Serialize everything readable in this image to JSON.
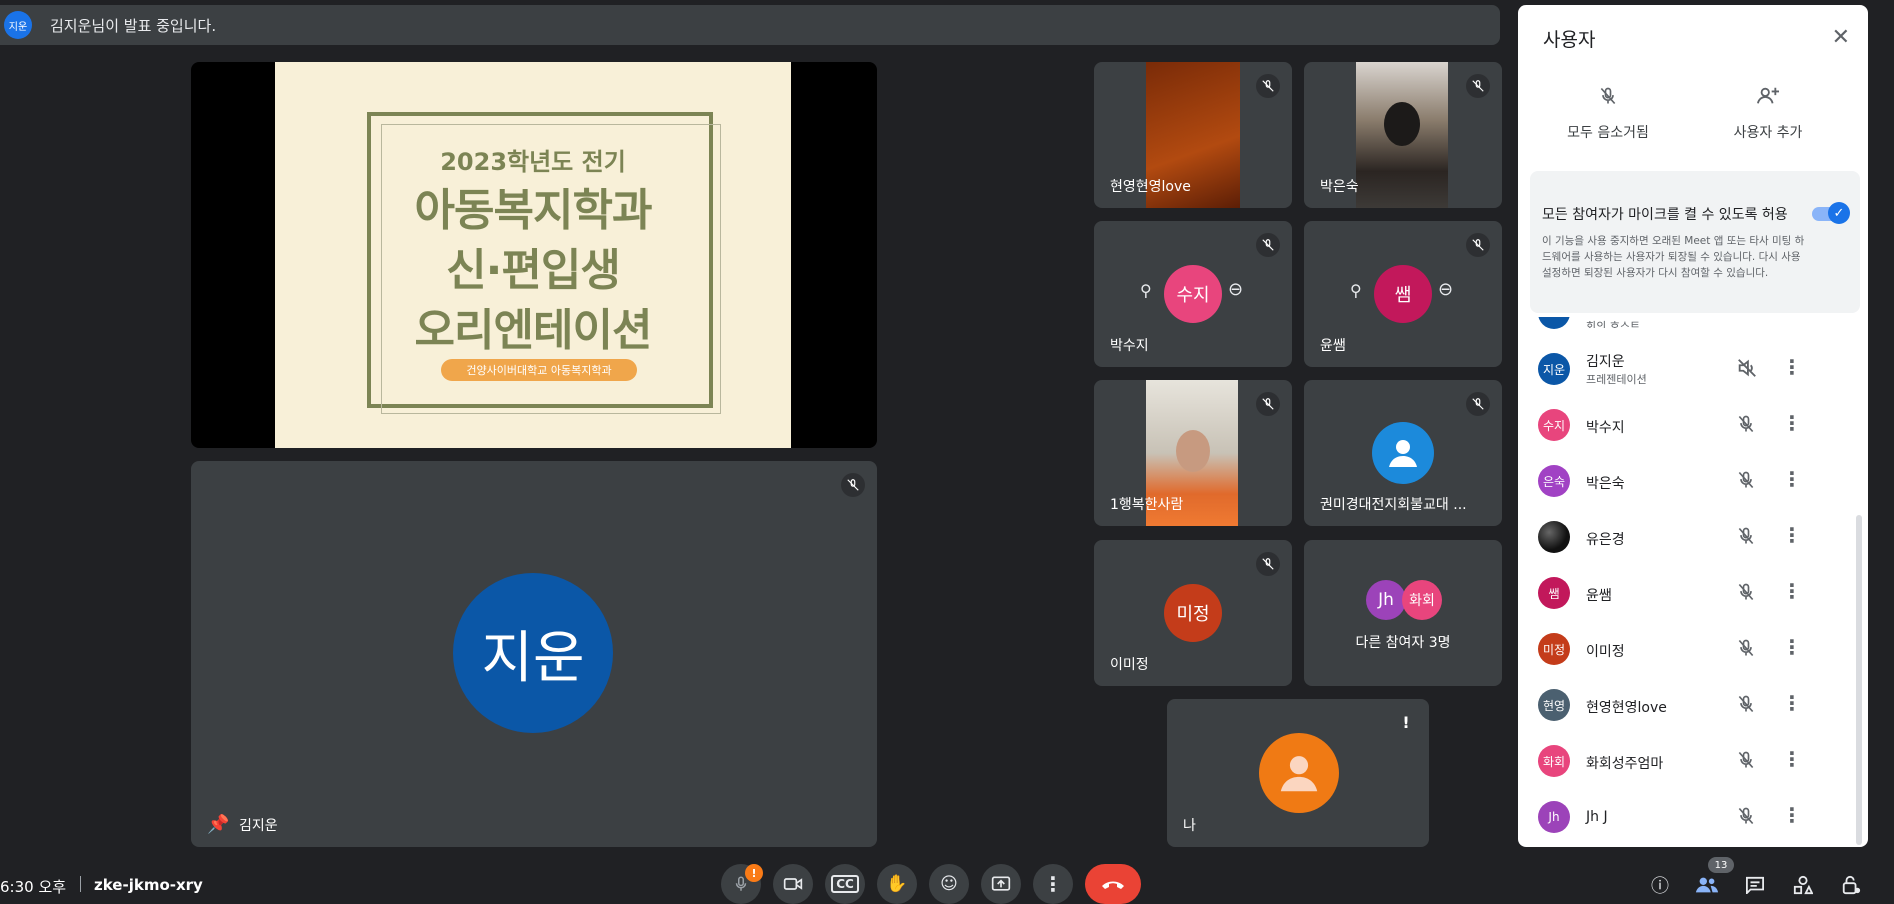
{
  "banner": {
    "avatar": "지운",
    "text": "김지운님이 발표 중입니다."
  },
  "slide": {
    "year": "2023학년도 전기",
    "line1": "아동복지학과",
    "line2": "신·편입생",
    "line3": "오리엔테이션",
    "pill": "건양사이버대학교 아동복지학과"
  },
  "presenter": {
    "avatar": "지운",
    "name": "김지운",
    "color": "#0b57a7"
  },
  "tiles": [
    {
      "name": "현영현영love"
    },
    {
      "name": "박은숙"
    },
    {
      "name": "박수지",
      "avatar": "수지"
    },
    {
      "name": "윤쌤",
      "avatar": "쌤"
    },
    {
      "name": "1행복한사람"
    },
    {
      "name": "권미경대전지회불교대 ..."
    },
    {
      "name": "이미정",
      "avatar": "미정"
    },
    {
      "name": "다른 참여자 3명",
      "av1": "Jh",
      "av2": "화회"
    },
    {
      "name": "나"
    }
  ],
  "panel": {
    "title": "사용자",
    "mute_all": "모두 음소거됨",
    "add_user": "사용자 추가",
    "allow_title": "모든 참여자가 마이크를 켤 수 있도록 허용",
    "allow_desc": "이 기능을 사용 중지하면 오래된 Meet 앱 또는 타사 미팅 하드웨어를 사용하는 사용자가 퇴장될 수 있습니다. 다시 사용 설정하면 퇴장된 사용자가 다시 참여할 수 있습니다.",
    "partial_row": "회의 호스트",
    "participants": [
      {
        "avatar": "지운",
        "name": "김지운",
        "sub": "프레젠테이션",
        "color": "#0b57a7"
      },
      {
        "avatar": "수지",
        "name": "박수지",
        "color": "#e8457d"
      },
      {
        "avatar": "은숙",
        "name": "박은숙",
        "color": "#a142c4"
      },
      {
        "avatar": "",
        "name": "유은경",
        "color": "#111111"
      },
      {
        "avatar": "쌤",
        "name": "윤쌤",
        "color": "#c2185b"
      },
      {
        "avatar": "미정",
        "name": "이미정",
        "color": "#c43c1a"
      },
      {
        "avatar": "현영",
        "name": "현영현영love",
        "color": "#4b6070"
      },
      {
        "avatar": "화회",
        "name": "화회성주엄마",
        "color": "#e8457d"
      },
      {
        "avatar": "Jh",
        "name": "Jh J",
        "color": "#9c43b9"
      }
    ]
  },
  "bottom": {
    "time": "6:30 오후",
    "code": "zke-jkmo-xry",
    "badge": "13"
  },
  "colors": {
    "end_call": "#ea4335",
    "accent": "#1a73e8",
    "alert": "#fa7b17"
  }
}
